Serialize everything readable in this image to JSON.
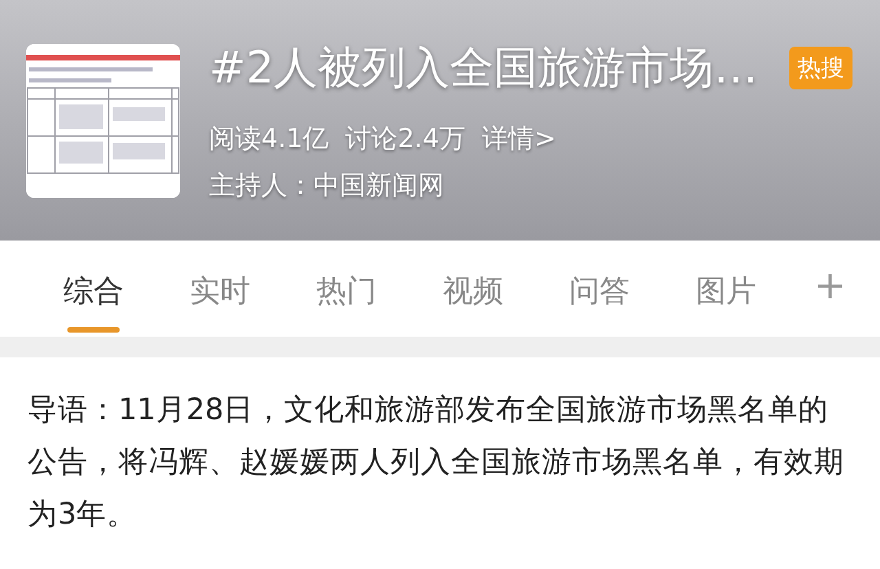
{
  "topic": {
    "title": "#2人被列入全国旅游市场…",
    "badge": "热搜",
    "stats": [
      "阅读4.1亿",
      "讨论2.4万",
      "详情>"
    ],
    "host": "主持人：中国新闻网"
  },
  "tabs": [
    {
      "label": "综合",
      "selected": true
    },
    {
      "label": "实时",
      "selected": false
    },
    {
      "label": "热门",
      "selected": false
    },
    {
      "label": "视频",
      "selected": false
    },
    {
      "label": "问答",
      "selected": false
    },
    {
      "label": "图片",
      "selected": false
    }
  ],
  "add_tab": "+",
  "intro": "导语：11月28日，文化和旅游部发布全国旅游市场黑名单的公告，将冯辉、赵媛媛两人列入全国旅游市场黑名单，有效期为3年。"
}
